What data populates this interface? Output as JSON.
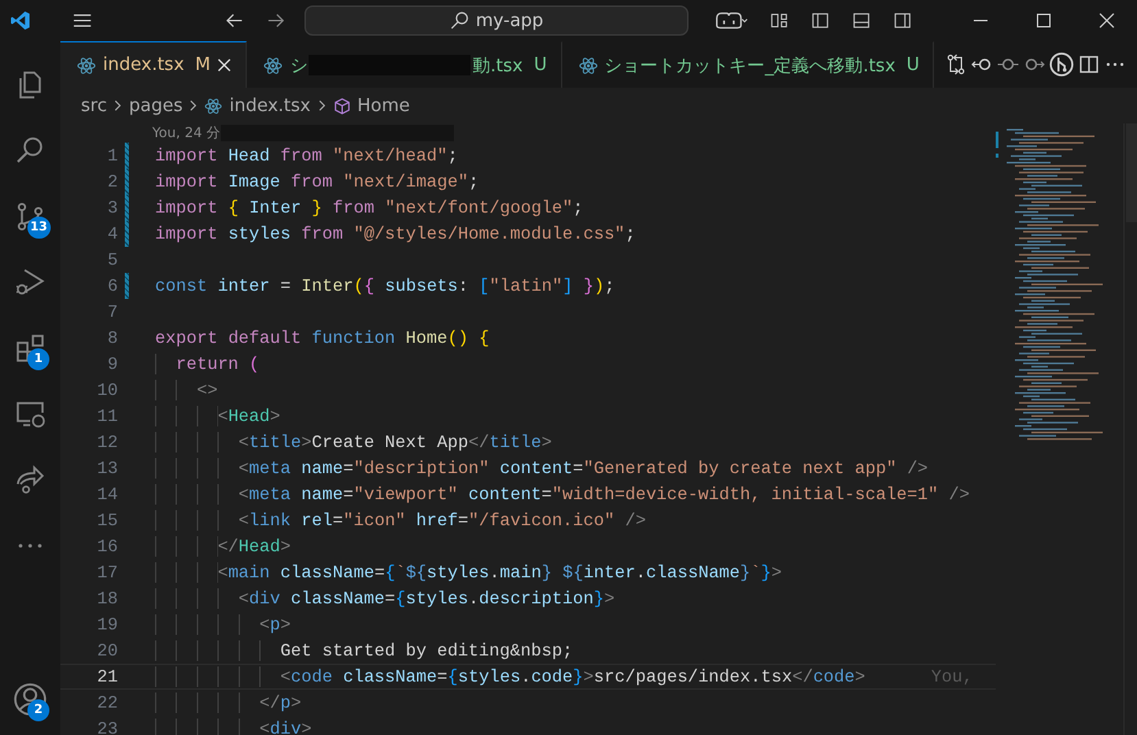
{
  "title_bar": {
    "search": "my-app"
  },
  "activity_bar": [
    {
      "kind": "files"
    },
    {
      "kind": "search"
    },
    {
      "kind": "source-control",
      "badge": "13"
    },
    {
      "kind": "debug"
    },
    {
      "kind": "extensions",
      "badge": "1"
    },
    {
      "kind": "remote"
    },
    {
      "kind": "share"
    },
    {
      "kind": "more"
    },
    {
      "kind": "account",
      "badge": "2"
    }
  ],
  "tabs": [
    {
      "label": "index.tsx",
      "status": "M",
      "kind": "modified",
      "selected": true,
      "redacted": false
    },
    {
      "label": "シ",
      "label_end": "動.tsx",
      "status": "U",
      "kind": "untracked",
      "selected": false,
      "redacted": true
    },
    {
      "label": "ショートカットキー_定義へ移動.tsx",
      "status": "U",
      "kind": "untracked",
      "selected": false,
      "redacted": false
    }
  ],
  "breadcrumbs": [
    {
      "text": "src",
      "kind": "folder"
    },
    {
      "text": "pages",
      "kind": "folder"
    },
    {
      "text": "index.tsx",
      "kind": "file"
    },
    {
      "text": "Home",
      "kind": "symbol"
    }
  ],
  "blame_header": "You, 24 分",
  "lines": [
    {
      "number": "1",
      "changed": true,
      "current": false,
      "code": "import Head from \"next/head\";"
    },
    {
      "number": "2",
      "changed": true,
      "current": false,
      "code": "import Image from \"next/image\";"
    },
    {
      "number": "3",
      "changed": true,
      "current": false,
      "code": "import { Inter } from \"next/font/google\";"
    },
    {
      "number": "4",
      "changed": true,
      "current": false,
      "code": "import styles from \"@/styles/Home.module.css\";"
    },
    {
      "number": "5",
      "changed": false,
      "current": false
    },
    {
      "number": "6",
      "changed": true,
      "current": false,
      "code": "const inter = Inter({ subsets: [\"latin\"] });"
    },
    {
      "number": "7",
      "changed": false,
      "current": false
    },
    {
      "number": "8",
      "changed": false,
      "current": false,
      "code": "export default function Home() {"
    },
    {
      "number": "9",
      "changed": false,
      "current": false,
      "code": "  return ("
    },
    {
      "number": "10",
      "changed": false,
      "current": false,
      "code": "    <>"
    },
    {
      "number": "11",
      "changed": false,
      "current": false,
      "code": "      <Head>"
    },
    {
      "number": "12",
      "changed": false,
      "current": false,
      "code": "        <title>Create Next App</title>"
    },
    {
      "number": "13",
      "changed": false,
      "current": false,
      "code": "        <meta name=\"description\" content=\"Generated by create next app\" />"
    },
    {
      "number": "14",
      "changed": false,
      "current": false,
      "code": "        <meta name=\"viewport\" content=\"width=device-width, initial-scale=1\" />"
    },
    {
      "number": "15",
      "changed": false,
      "current": false,
      "code": "        <link rel=\"icon\" href=\"/favicon.ico\" />"
    },
    {
      "number": "16",
      "changed": false,
      "current": false,
      "code": "      </Head>"
    },
    {
      "number": "17",
      "changed": false,
      "current": false,
      "code": "      <main className={`${styles.main} ${inter.className}`}>"
    },
    {
      "number": "18",
      "changed": false,
      "current": false,
      "code": "        <div className={styles.description}>"
    },
    {
      "number": "19",
      "changed": false,
      "current": false,
      "code": "          <p>"
    },
    {
      "number": "20",
      "changed": false,
      "current": false,
      "code": "            Get started by editing&nbsp;"
    },
    {
      "number": "21",
      "changed": false,
      "current": true,
      "blame": "You,",
      "code": "            <code className={styles.code}>src/pages/index.tsx</code>"
    },
    {
      "number": "22",
      "changed": false,
      "current": false,
      "code": "          </p>"
    },
    {
      "number": "23",
      "changed": false,
      "current": false,
      "code": "          <div>"
    }
  ]
}
